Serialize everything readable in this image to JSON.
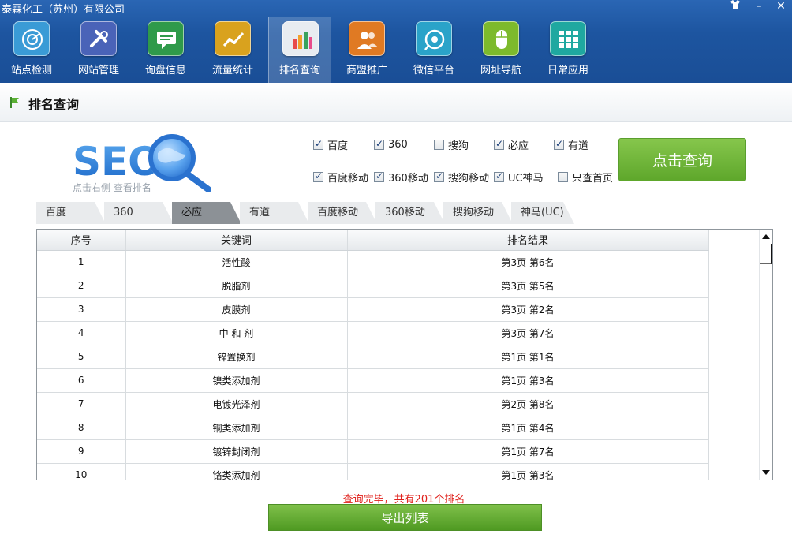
{
  "window": {
    "title": "泰霖化工（苏州）有限公司"
  },
  "toolbar": {
    "items": [
      {
        "label": "站点检测",
        "icon": "radar-icon",
        "color": "#3a9bd6"
      },
      {
        "label": "网站管理",
        "icon": "tools-icon",
        "color": "#4a63b8"
      },
      {
        "label": "询盘信息",
        "icon": "message-icon",
        "color": "#2f9a4a"
      },
      {
        "label": "流量统计",
        "icon": "trend-icon",
        "color": "#d9a21e"
      },
      {
        "label": "排名查询",
        "icon": "bar-chart-icon",
        "color": "#e8ecf1"
      },
      {
        "label": "商盟推广",
        "icon": "users-icon",
        "color": "#e07a23"
      },
      {
        "label": "微信平台",
        "icon": "wechat-icon",
        "color": "#2aa3c9"
      },
      {
        "label": "网址导航",
        "icon": "mouse-icon",
        "color": "#7dba2c"
      },
      {
        "label": "日常应用",
        "icon": "apps-grid-icon",
        "color": "#1fa8a0"
      }
    ],
    "active": "排名查询"
  },
  "page": {
    "title": "排名查询"
  },
  "logo": {
    "text": "SEO",
    "subtitle": "点击右侧  查看排名"
  },
  "engines": {
    "row1": [
      {
        "label": "百度",
        "checked": true
      },
      {
        "label": "360",
        "checked": true
      },
      {
        "label": "搜狗",
        "checked": false
      },
      {
        "label": "必应",
        "checked": true
      },
      {
        "label": "有道",
        "checked": true
      }
    ],
    "row2": [
      {
        "label": "百度移动",
        "checked": true
      },
      {
        "label": "360移动",
        "checked": true
      },
      {
        "label": "搜狗移动",
        "checked": true
      },
      {
        "label": "UC神马",
        "checked": true
      },
      {
        "label": "只查首页",
        "checked": false
      }
    ]
  },
  "query_button": "点击查询",
  "tabs": {
    "items": [
      "百度",
      "360",
      "必应",
      "有道",
      "百度移动",
      "360移动",
      "搜狗移动",
      "神马(UC)"
    ],
    "active": "必应"
  },
  "results": {
    "columns": [
      "序号",
      "关键词",
      "排名结果"
    ],
    "rows": [
      [
        "1",
        "活性酸",
        "第3页 第6名"
      ],
      [
        "2",
        "脱脂剂",
        "第3页 第5名"
      ],
      [
        "3",
        "皮膜剂",
        "第3页 第2名"
      ],
      [
        "4",
        "中 和 剂",
        "第3页 第7名"
      ],
      [
        "5",
        "锌置换剂",
        "第1页 第1名"
      ],
      [
        "6",
        "镍类添加剂",
        "第1页 第3名"
      ],
      [
        "7",
        "电镀光泽剂",
        "第2页 第8名"
      ],
      [
        "8",
        "铜类添加剂",
        "第1页 第4名"
      ],
      [
        "9",
        "镀锌封闭剂",
        "第1页 第7名"
      ],
      [
        "10",
        "铬类添加剂",
        "第1页 第3名"
      ]
    ]
  },
  "status_text": "查询完毕，共有201个排名",
  "export_button": "导出列表"
}
